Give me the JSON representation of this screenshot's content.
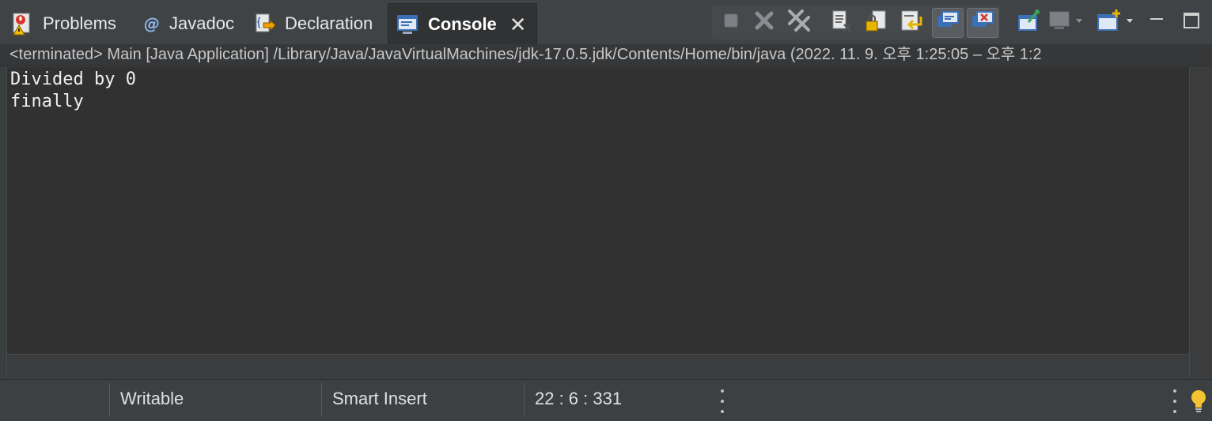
{
  "tabs": [
    {
      "label": "Problems",
      "icon": "problems-icon"
    },
    {
      "label": "Javadoc",
      "icon": "javadoc-icon"
    },
    {
      "label": "Declaration",
      "icon": "declaration-icon"
    },
    {
      "label": "Console",
      "icon": "console-icon",
      "active": true
    }
  ],
  "process_line": "<terminated> Main [Java Application] /Library/Java/JavaVirtualMachines/jdk-17.0.5.jdk/Contents/Home/bin/java  (2022. 11. 9. 오후 1:25:05 – 오후 1:2",
  "console_lines": [
    "Divided by 0",
    "finally"
  ],
  "statusbar": {
    "writable": "Writable",
    "insert_mode": "Smart Insert",
    "position": "22 : 6 : 331"
  },
  "colors": {
    "accent_blue": "#3c6fb4",
    "error_red": "#d9342b",
    "warning_yellow": "#e8b400",
    "green": "#3aa657"
  }
}
